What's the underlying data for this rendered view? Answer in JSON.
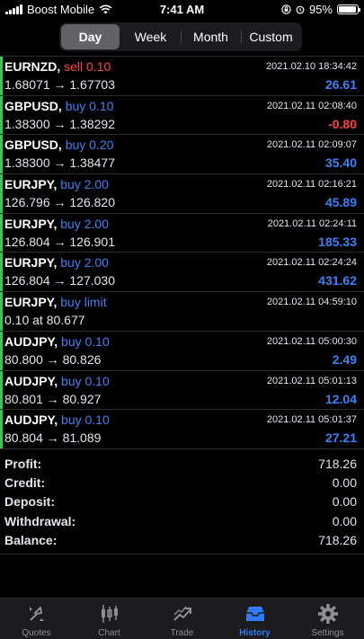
{
  "status": {
    "carrier": "Boost Mobile",
    "time": "7:41 AM",
    "battery": "95%",
    "battery_level": 0.95
  },
  "segments": [
    {
      "label": "Day",
      "active": true
    },
    {
      "label": "Week",
      "active": false
    },
    {
      "label": "Month",
      "active": false
    },
    {
      "label": "Custom",
      "active": false
    }
  ],
  "trades": [
    {
      "symbol": "EURNZD,",
      "type": "sell 0.10",
      "side": "sell",
      "time": "2021.02.10 18:34:42",
      "prices": "1.68071 → 1.67703",
      "profit": "26.61",
      "sign": "pos"
    },
    {
      "symbol": "GBPUSD,",
      "type": "buy 0.10",
      "side": "buy",
      "time": "2021.02.11 02:08:40",
      "prices": "1.38300 → 1.38292",
      "profit": "-0.80",
      "sign": "neg"
    },
    {
      "symbol": "GBPUSD,",
      "type": "buy 0.20",
      "side": "buy",
      "time": "2021.02.11 02:09:07",
      "prices": "1.38300 → 1.38477",
      "profit": "35.40",
      "sign": "pos"
    },
    {
      "symbol": "EURJPY,",
      "type": "buy 2.00",
      "side": "buy",
      "time": "2021.02.11 02:16:21",
      "prices": "126.796 → 126.820",
      "profit": "45.89",
      "sign": "pos"
    },
    {
      "symbol": "EURJPY,",
      "type": "buy 2.00",
      "side": "buy",
      "time": "2021.02.11 02:24:11",
      "prices": "126.804 → 126.901",
      "profit": "185.33",
      "sign": "pos"
    },
    {
      "symbol": "EURJPY,",
      "type": "buy 2.00",
      "side": "buy",
      "time": "2021.02.11 02:24:24",
      "prices": "126.804 → 127.030",
      "profit": "431.62",
      "sign": "pos"
    },
    {
      "symbol": "EURJPY,",
      "type": "buy limit",
      "side": "buy",
      "time": "2021.02.11 04:59:10",
      "prices": "0.10 at 80.677",
      "profit": "",
      "sign": "pos"
    },
    {
      "symbol": "AUDJPY,",
      "type": "buy 0.10",
      "side": "buy",
      "time": "2021.02.11 05:00:30",
      "prices": "80.800 → 80.826",
      "profit": "2.49",
      "sign": "pos"
    },
    {
      "symbol": "AUDJPY,",
      "type": "buy 0.10",
      "side": "buy",
      "time": "2021.02.11 05:01:13",
      "prices": "80.801 → 80.927",
      "profit": "12.04",
      "sign": "pos"
    },
    {
      "symbol": "AUDJPY,",
      "type": "buy 0.10",
      "side": "buy",
      "time": "2021.02.11 05:01:37",
      "prices": "80.804 → 81.089",
      "profit": "27.21",
      "sign": "pos"
    }
  ],
  "summary": [
    {
      "label": "Profit:",
      "value": "718.26"
    },
    {
      "label": "Credit:",
      "value": "0.00"
    },
    {
      "label": "Deposit:",
      "value": "0.00"
    },
    {
      "label": "Withdrawal:",
      "value": "0.00"
    },
    {
      "label": "Balance:",
      "value": "718.26"
    }
  ],
  "tabs": [
    {
      "label": "Quotes",
      "icon": "quotes-icon",
      "active": false
    },
    {
      "label": "Chart",
      "icon": "chart-icon",
      "active": false
    },
    {
      "label": "Trade",
      "icon": "trade-icon",
      "active": false
    },
    {
      "label": "History",
      "icon": "history-icon",
      "active": true
    },
    {
      "label": "Settings",
      "icon": "settings-icon",
      "active": false
    }
  ],
  "colors": {
    "buy": "#3b82f6",
    "sell": "#ff453a",
    "accent": "#2f7cf6",
    "row_marker": "#34c759"
  }
}
